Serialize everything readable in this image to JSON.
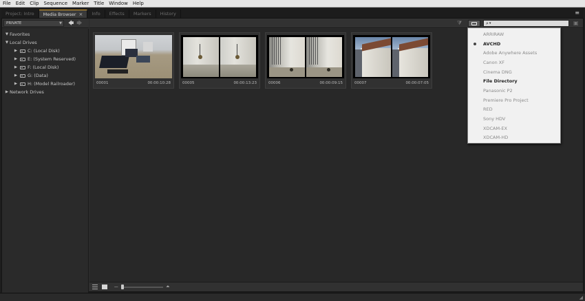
{
  "menu": [
    "File",
    "Edit",
    "Clip",
    "Sequence",
    "Marker",
    "Title",
    "Window",
    "Help"
  ],
  "tabs": [
    {
      "label": "Project: Intro"
    },
    {
      "label": "Media Browser"
    },
    {
      "label": "Info"
    },
    {
      "label": "Effects"
    },
    {
      "label": "Markers"
    },
    {
      "label": "History"
    }
  ],
  "panel_menu_glyph": "≡",
  "left_toolbar": {
    "view_select": "PRIVATE",
    "back_arrow": "🡄",
    "forward_arrow": "🡆"
  },
  "tree": [
    {
      "label": "Favorites",
      "level": 0,
      "twisty": "▼"
    },
    {
      "label": "Local Drives",
      "level": 0,
      "twisty": "▼"
    },
    {
      "label": "C: (Local Disk)",
      "level": 1,
      "twisty": "▶"
    },
    {
      "label": "E: (System Reserved)",
      "level": 1,
      "twisty": "▶"
    },
    {
      "label": "F: (Local Disk)",
      "level": 1,
      "twisty": "▶"
    },
    {
      "label": "G: (Data)",
      "level": 1,
      "twisty": "▶"
    },
    {
      "label": "H: (Model Railroader)",
      "level": 1,
      "twisty": "▶"
    },
    {
      "label": "Network Drives",
      "level": 0,
      "twisty": "▶"
    }
  ],
  "clips": [
    {
      "name": "00001",
      "duration": "00:00:10:28"
    },
    {
      "name": "00005",
      "duration": "00:00:13:23"
    },
    {
      "name": "00006",
      "duration": "00:00:09:15"
    },
    {
      "name": "00007",
      "duration": "00:00:07:05"
    }
  ],
  "search": {
    "magnifier": "⌕",
    "caret": "▾",
    "value": ""
  },
  "source_menu": {
    "selected": "AVCHD",
    "items": [
      {
        "label": "ARRIRAW",
        "bold": false
      },
      {
        "label": "AVCHD",
        "bold": true
      },
      {
        "label": "Adobe Anywhere Assets",
        "bold": false
      },
      {
        "label": "Canon XF",
        "bold": false
      },
      {
        "label": "Cinema DNG",
        "bold": false
      },
      {
        "label": "File Directory",
        "bold": true
      },
      {
        "label": "Panasonic P2",
        "bold": false
      },
      {
        "label": "Premiere Pro Project",
        "bold": false
      },
      {
        "label": "RED",
        "bold": false
      },
      {
        "label": "Sony HDV",
        "bold": false
      },
      {
        "label": "XDCAM-EX",
        "bold": false
      },
      {
        "label": "XDCAM-HD",
        "bold": false
      }
    ]
  },
  "colors": {
    "active_tab_accent": "#d8a02a",
    "panel_bg": "#2d2d2d",
    "menu_bg": "#f1f1f1"
  }
}
